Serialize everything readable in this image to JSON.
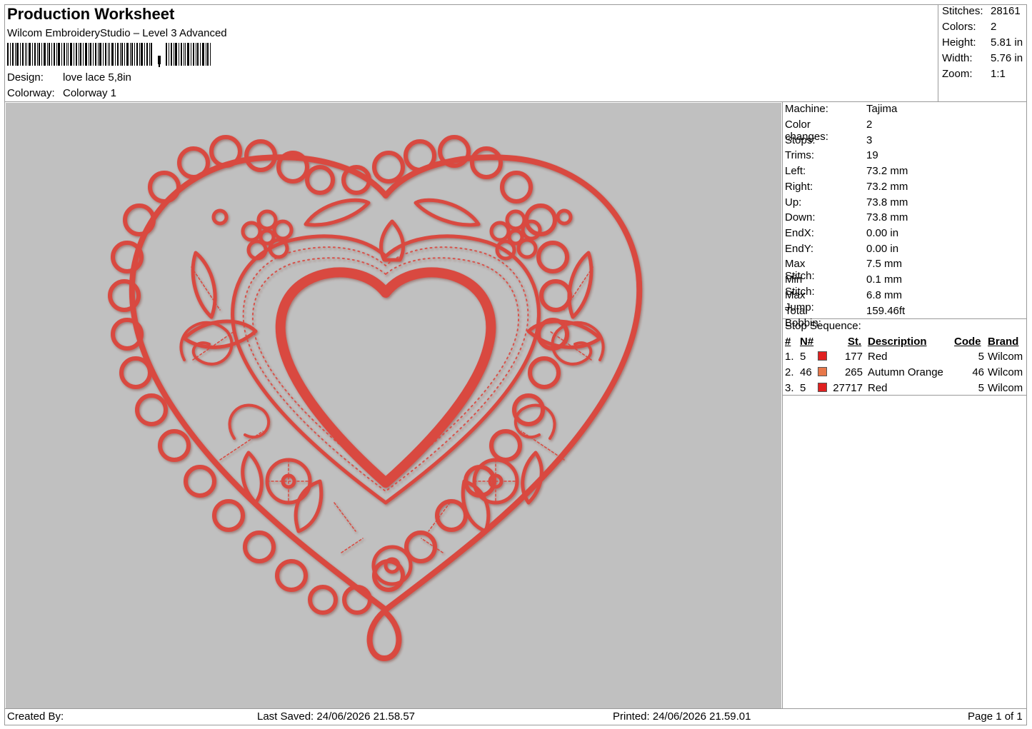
{
  "header": {
    "title": "Production Worksheet",
    "software": "Wilcom EmbroideryStudio – Level 3 Advanced",
    "design_label": "Design:",
    "design_value": "love lace 5,8in",
    "colorway_label": "Colorway:",
    "colorway_value": "Colorway 1"
  },
  "summary": [
    {
      "label": "Stitches:",
      "value": "28161"
    },
    {
      "label": "Colors:",
      "value": "2"
    },
    {
      "label": "Height:",
      "value": "5.81 in"
    },
    {
      "label": "Width:",
      "value": "5.76 in"
    },
    {
      "label": "Zoom:",
      "value": "1:1"
    }
  ],
  "details": [
    {
      "label": "Machine:",
      "value": "Tajima"
    },
    {
      "label": "Color changes:",
      "value": "2"
    },
    {
      "label": "Stops:",
      "value": "3"
    },
    {
      "label": "Trims:",
      "value": "19"
    },
    {
      "label": "Left:",
      "value": "73.2 mm"
    },
    {
      "label": "Right:",
      "value": "73.2 mm"
    },
    {
      "label": "Up:",
      "value": "73.8 mm"
    },
    {
      "label": "Down:",
      "value": "73.8 mm"
    },
    {
      "label": "EndX:",
      "value": "0.00 in"
    },
    {
      "label": "EndY:",
      "value": "0.00 in"
    },
    {
      "label": "Max Stitch:",
      "value": "7.5 mm"
    },
    {
      "label": "Min Stitch:",
      "value": "0.1 mm"
    },
    {
      "label": "Max Jump:",
      "value": "6.8 mm"
    },
    {
      "label": "Total Bobbin:",
      "value": "159.46ft"
    }
  ],
  "stop_sequence": {
    "title": "Stop Sequence:",
    "columns": {
      "num": "#",
      "needle": "N#",
      "stitches": "St.",
      "description": "Description",
      "code": "Code",
      "brand": "Brand"
    },
    "rows": [
      {
        "num": "1.",
        "needle": "5",
        "color": "#e02020",
        "stitches": "177",
        "description": "Red",
        "code": "5",
        "brand": "Wilcom"
      },
      {
        "num": "2.",
        "needle": "46",
        "color": "#e8784a",
        "stitches": "265",
        "description": "Autumn Orange",
        "code": "46",
        "brand": "Wilcom"
      },
      {
        "num": "3.",
        "needle": "5",
        "color": "#e02020",
        "stitches": "27717",
        "description": "Red",
        "code": "5",
        "brand": "Wilcom"
      }
    ]
  },
  "design_preview": {
    "background": "#c0c0c0",
    "thread_color": "#d94840",
    "icon": "heart-lace-embroidery"
  },
  "footer": {
    "created_by": "Created By:",
    "last_saved": "Last Saved: 24/06/2026 21.58.57",
    "printed": "Printed: 24/06/2026 21.59.01",
    "page": "Page 1 of 1"
  }
}
